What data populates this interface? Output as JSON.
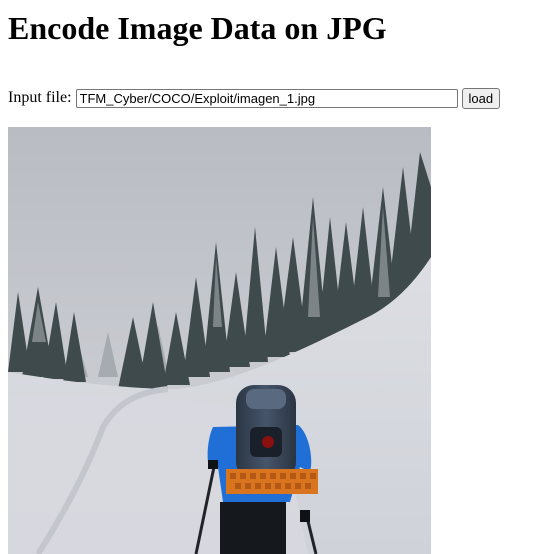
{
  "page": {
    "title": "Encode Image Data on JPG"
  },
  "file_form": {
    "label": "Input file:",
    "value": "TFM_Cyber/COCO/Exploit/imagen_1.jpg",
    "button_label": "load"
  },
  "loaded_image": {
    "alt": "Skier with a backpack climbing a snowy slope between snow-covered fir trees"
  }
}
